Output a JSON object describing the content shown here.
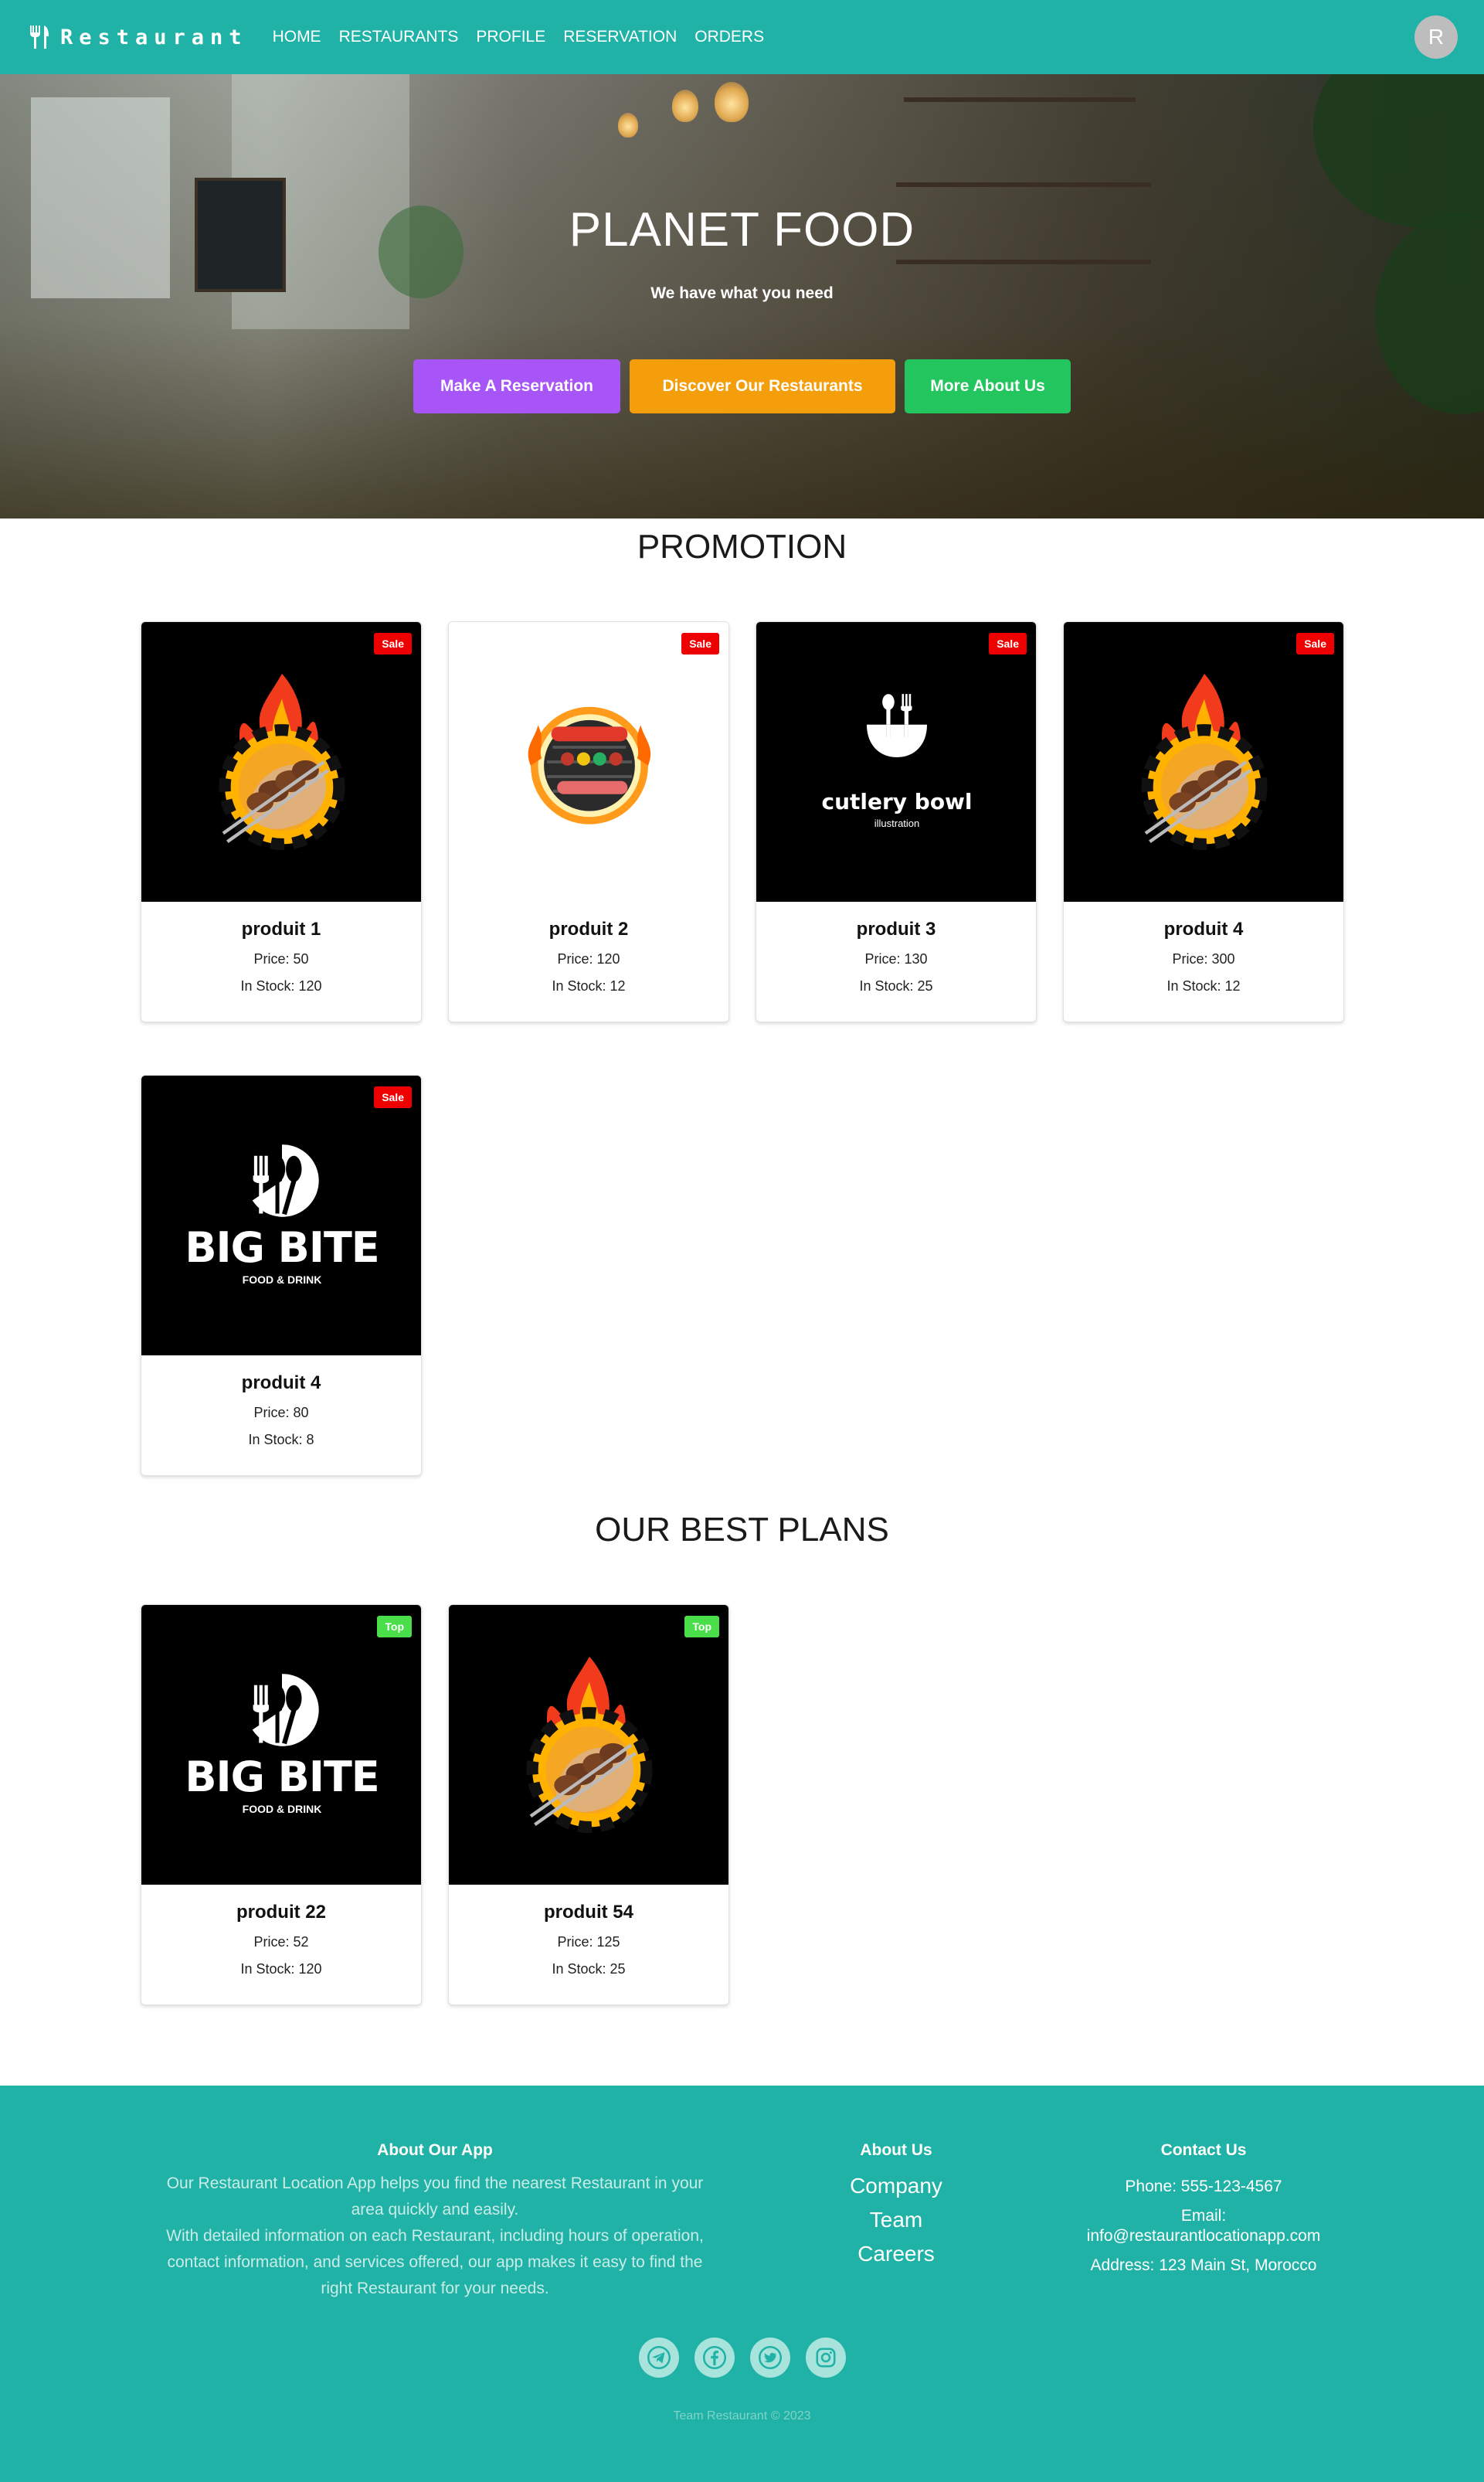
{
  "navbar": {
    "brand": "Restaurant",
    "links": [
      "HOME",
      "RESTAURANTS",
      "PROFILE",
      "RESERVATION",
      "ORDERS"
    ],
    "avatar_letter": "R"
  },
  "hero": {
    "title": "PLANET FOOD",
    "subtitle": "We have what you need",
    "buttons": [
      "Make A Reservation",
      "Discover Our Restaurants",
      "More About Us"
    ]
  },
  "promotion": {
    "title": "PROMOTION",
    "cards": [
      {
        "name": "produit 1",
        "price": "Price: 50",
        "stock": "In Stock: 120",
        "badge": "Sale",
        "image": "grill-kebab-logo"
      },
      {
        "name": "produit 2",
        "price": "Price: 120",
        "stock": "In Stock: 12",
        "badge": "Sale",
        "image": "bbq-grill-logo"
      },
      {
        "name": "produit 3",
        "price": "Price: 130",
        "stock": "In Stock: 25",
        "badge": "Sale",
        "image": "cutlery-bowl-logo",
        "image_text": "cutlery bowl",
        "image_subtext": "illustration"
      },
      {
        "name": "produit 4",
        "price": "Price: 300",
        "stock": "In Stock: 12",
        "badge": "Sale",
        "image": "grill-kebab-logo"
      },
      {
        "name": "produit 4",
        "price": "Price: 80",
        "stock": "In Stock: 8",
        "badge": "Sale",
        "image": "big-bite-logo",
        "image_text": "BIG BITE",
        "image_subtext": "FOOD & DRINK"
      }
    ]
  },
  "plans": {
    "title": "OUR BEST PLANS",
    "cards": [
      {
        "name": "produit 22",
        "price": "Price: 52",
        "stock": "In Stock: 120",
        "badge": "Top",
        "image": "big-bite-logo",
        "image_text": "BIG BITE",
        "image_subtext": "FOOD & DRINK"
      },
      {
        "name": "produit 54",
        "price": "Price: 125",
        "stock": "In Stock: 25",
        "badge": "Top",
        "image": "grill-kebab-logo"
      }
    ]
  },
  "footer": {
    "about_app": {
      "heading": "About Our App",
      "lines": [
        "Our Restaurant Location App helps you find the nearest Restaurant in your",
        "area quickly and easily.",
        "With detailed information on each Restaurant, including hours of operation,",
        "contact information, and services offered, our app makes it easy to find the",
        "right Restaurant for your needs."
      ]
    },
    "about_us": {
      "heading": "About Us",
      "links": [
        "Company",
        "Team",
        "Careers"
      ]
    },
    "contact": {
      "heading": "Contact Us",
      "phone": "Phone: 555-123-4567",
      "email_label": "Email:",
      "email": "info@restaurantlocationapp.com",
      "address": "Address: 123 Main St, Morocco"
    },
    "socials": [
      "telegram-icon",
      "facebook-icon",
      "twitter-icon",
      "instagram-icon"
    ],
    "copyright": "Team Restaurant © 2023"
  },
  "colors": {
    "primary": "#20b2a6",
    "sale": "#ef0000",
    "top": "#4ade4a",
    "btn_purple": "#a855f7",
    "btn_orange": "#f59e0b",
    "btn_green": "#22c55e"
  }
}
